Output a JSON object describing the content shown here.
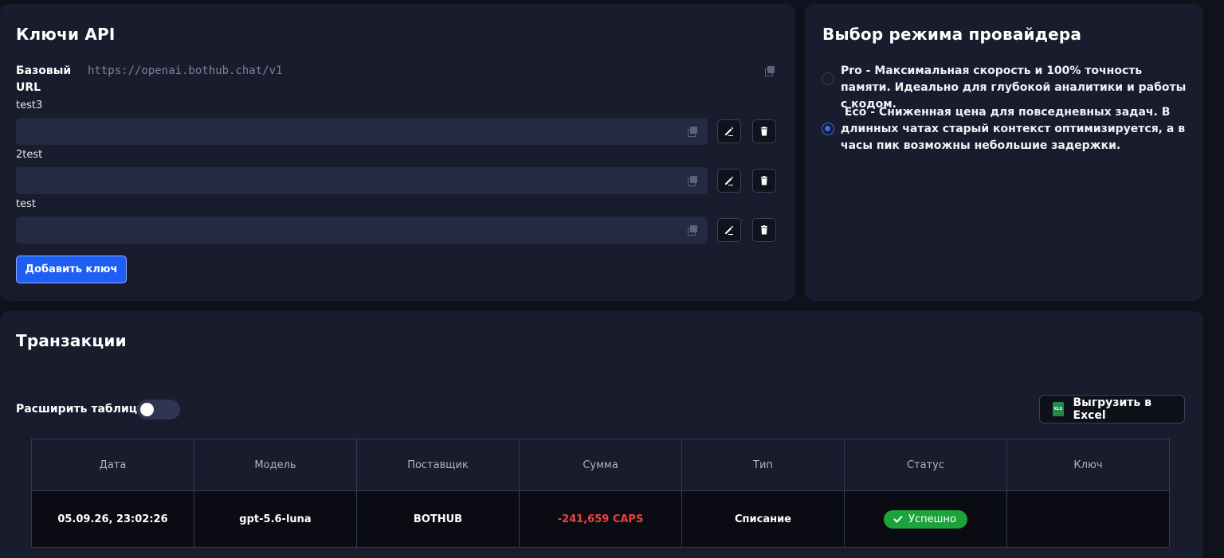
{
  "api_keys": {
    "title": "Ключи API",
    "base_url_label": "Базовый URL",
    "base_url_value": "https://openai.bothub.chat/v1",
    "keys": [
      {
        "name": "test3"
      },
      {
        "name": "2test"
      },
      {
        "name": "test"
      }
    ],
    "add_key_label": "Добавить ключ"
  },
  "provider_mode": {
    "title": "Выбор режима провайдера",
    "options": [
      {
        "text": "Pro - Максимальная скорость и 100% точность памяти. Идеально для глубокой аналитики и работы с кодом.",
        "selected": false
      },
      {
        "text": " Eco - Сниженная цена для повседневных задач. В длинных чатах старый контекст оптимизируется, а в часы пик возможны небольшие задержки.",
        "selected": true
      }
    ]
  },
  "transactions": {
    "title": "Транзакции",
    "expand_label": "Расширить таблицу",
    "expand_on": false,
    "export_label": "Выгрузить в Excel",
    "export_icon_text": "XLS",
    "columns": [
      "Дата",
      "Модель",
      "Поставщик",
      "Сумма",
      "Тип",
      "Статус",
      "Ключ"
    ],
    "rows": [
      {
        "date": "05.09.26, 23:02:26",
        "model": "gpt-5.6-luna",
        "provider": "BOTHUB",
        "amount": "-241,659 CAPS",
        "type": "Списание",
        "status": "Успешно",
        "key": ""
      }
    ]
  },
  "colors": {
    "accent": "#1e5ef5",
    "negative_amount": "#ef4040",
    "success": "#1da33b"
  }
}
